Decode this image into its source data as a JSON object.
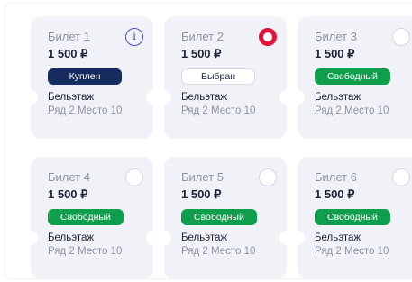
{
  "tickets": [
    {
      "title": "Билет 1",
      "price": "1 500 ₽",
      "status": "Куплен",
      "venue": "Бельэтаж",
      "seat": "Ряд 2  Место 10",
      "corner_glyph": "i"
    },
    {
      "title": "Билет 2",
      "price": "1 500 ₽",
      "status": "Выбран",
      "venue": "Бельэтаж",
      "seat": "Ряд 2  Место 10"
    },
    {
      "title": "Билет 3",
      "price": "1 500 ₽",
      "status": "Свободный",
      "venue": "Бельэтаж",
      "seat": "Ряд 2  Место 10"
    },
    {
      "title": "Билет 4",
      "price": "1 500 ₽",
      "status": "Свободный",
      "venue": "Бельэтаж",
      "seat": "Ряд 2  Место 10"
    },
    {
      "title": "Билет 5",
      "price": "1 500 ₽",
      "status": "Свободный",
      "venue": "Бельэтаж",
      "seat": "Ряд 2  Место 10"
    },
    {
      "title": "Билет 6",
      "price": "1 500 ₽",
      "status": "Свободный",
      "venue": "Бельэтаж",
      "seat": "Ряд 2  Место 10"
    }
  ],
  "colors": {
    "bought_badge": "#162b5e",
    "free_badge": "#0e9e4c",
    "selected_radio": "#e3143b",
    "info_icon": "#4a4fc4",
    "card_background": "#f1f2f7"
  },
  "icons": {
    "ticket_1": "info-icon",
    "ticket_2": "radio-selected-icon",
    "ticket_3": "radio-icon",
    "ticket_4": "radio-icon",
    "ticket_5": "radio-icon",
    "ticket_6": "radio-icon"
  }
}
